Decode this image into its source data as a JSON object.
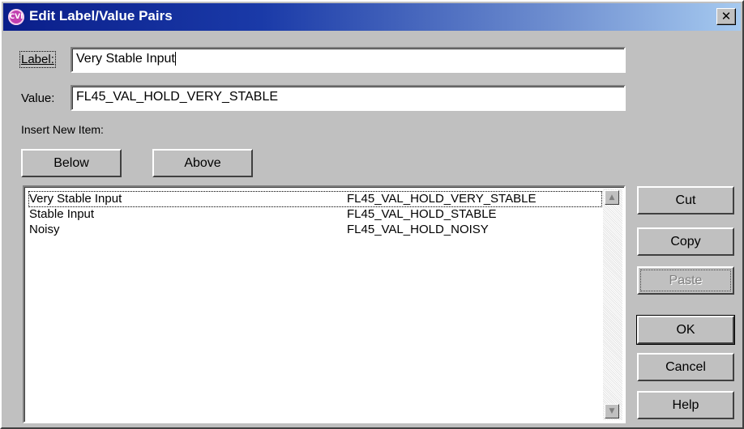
{
  "window": {
    "title": "Edit Label/Value Pairs",
    "icon_text": "CVI",
    "icon_name": "cvi-app-icon",
    "close_glyph": "✕"
  },
  "form": {
    "label_field": {
      "label": "Label:",
      "value": "Very Stable Input"
    },
    "value_field": {
      "label": "Value:",
      "value": "FL45_VAL_HOLD_VERY_STABLE"
    },
    "insert_new_item_label": "Insert New Item:"
  },
  "buttons": {
    "below": "Below",
    "above": "Above",
    "cut": "Cut",
    "copy": "Copy",
    "paste": "Paste",
    "ok": "OK",
    "cancel": "Cancel",
    "help": "Help"
  },
  "list": {
    "items": [
      {
        "label": "Very Stable Input",
        "value": "FL45_VAL_HOLD_VERY_STABLE",
        "selected": true
      },
      {
        "label": "Stable Input",
        "value": "FL45_VAL_HOLD_STABLE",
        "selected": false
      },
      {
        "label": "Noisy",
        "value": "FL45_VAL_HOLD_NOISY",
        "selected": false
      }
    ],
    "scroll_up_glyph": "▲",
    "scroll_down_glyph": "▼"
  },
  "colors": {
    "title_gradient_start": "#0a1e8a",
    "title_gradient_end": "#a6caf0",
    "face": "#c0c0c0",
    "icon": "#c23fb0"
  }
}
